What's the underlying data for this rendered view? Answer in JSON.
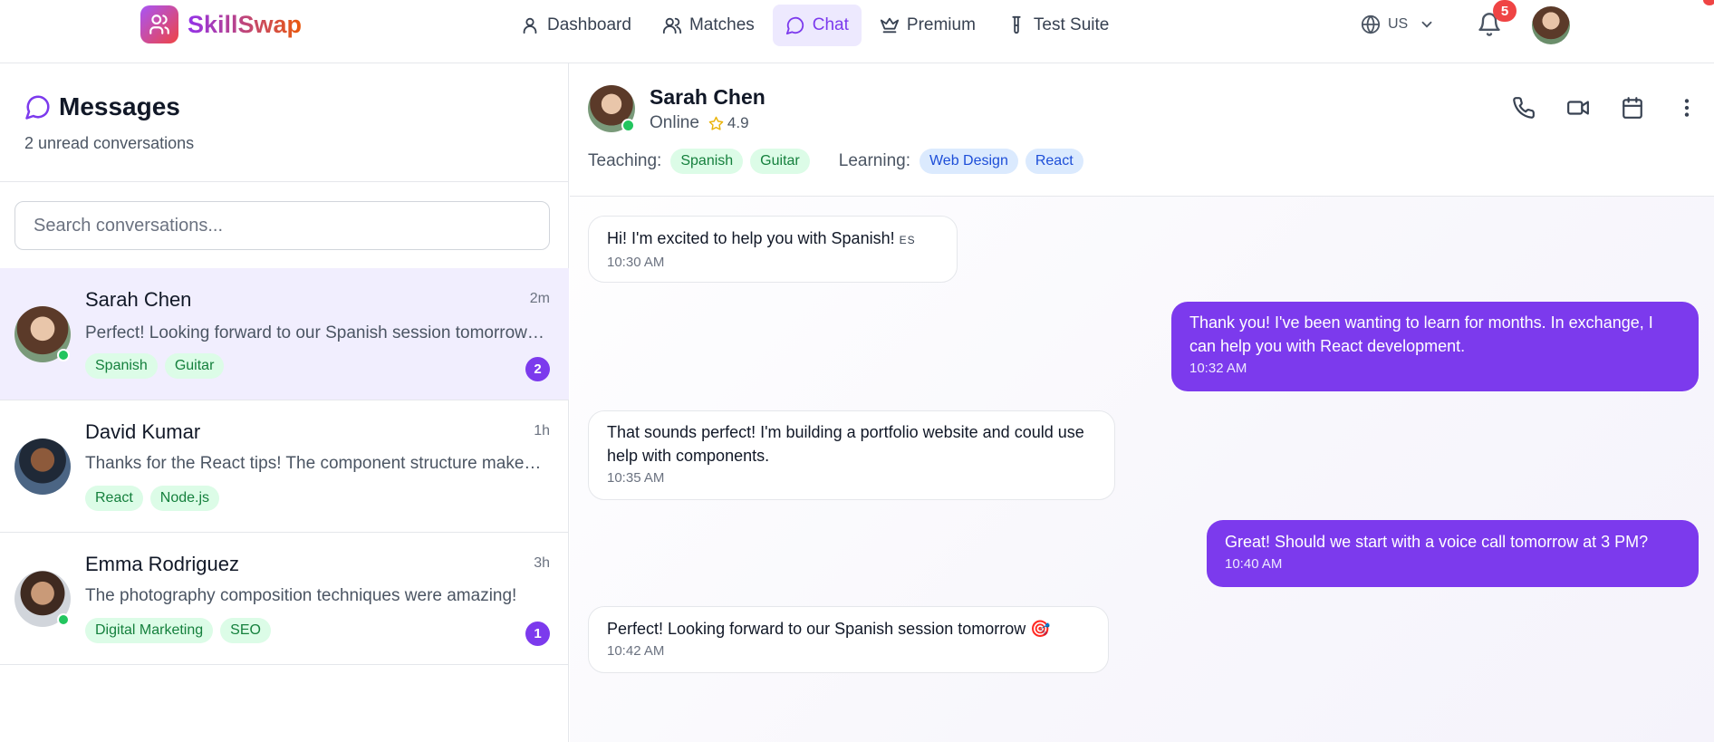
{
  "brand": {
    "name": "SkillSwap"
  },
  "nav": {
    "items": [
      {
        "label": "Dashboard",
        "icon": "user-icon"
      },
      {
        "label": "Matches",
        "icon": "users-icon"
      },
      {
        "label": "Chat",
        "icon": "message-icon",
        "active": true
      },
      {
        "label": "Premium",
        "icon": "crown-icon"
      },
      {
        "label": "Test Suite",
        "icon": "test-tube-icon"
      }
    ],
    "language": "US",
    "notification_count": "5"
  },
  "sidebar": {
    "title": "Messages",
    "subtitle": "2 unread conversations",
    "search_placeholder": "Search conversations...",
    "conversations": [
      {
        "name": "Sarah Chen",
        "time": "2m",
        "preview": "Perfect! Looking forward to our Spanish session tomorrow 🎯",
        "tags": [
          "Spanish",
          "Guitar"
        ],
        "unread": "2",
        "online": true
      },
      {
        "name": "David Kumar",
        "time": "1h",
        "preview": "Thanks for the React tips! The component structure makes so much more sense now.",
        "tags": [
          "React",
          "Node.js"
        ],
        "unread": "",
        "online": false
      },
      {
        "name": "Emma Rodriguez",
        "time": "3h",
        "preview": "The photography composition techniques were amazing!",
        "tags": [
          "Digital Marketing",
          "SEO"
        ],
        "unread": "1",
        "online": true
      }
    ]
  },
  "chat": {
    "name": "Sarah Chen",
    "status": "Online",
    "rating": "4.9",
    "teaching_label": "Teaching:",
    "teaching": [
      "Spanish",
      "Guitar"
    ],
    "learning_label": "Learning:",
    "learning": [
      "Web Design",
      "React"
    ],
    "messages": [
      {
        "direction": "in",
        "text": "Hi! I'm excited to help you with Spanish!",
        "flag": "ES",
        "time": "10:30 AM"
      },
      {
        "direction": "out",
        "text": "Thank you! I've been wanting to learn for months. In exchange, I can help you with React development.",
        "time": "10:32 AM"
      },
      {
        "direction": "in",
        "text": "That sounds perfect! I'm building a portfolio website and could use help with components.",
        "time": "10:35 AM"
      },
      {
        "direction": "out",
        "text": "Great! Should we start with a voice call tomorrow at 3 PM?",
        "time": "10:40 AM"
      },
      {
        "direction": "in",
        "text": "Perfect! Looking forward to our Spanish session tomorrow",
        "emoji": "🎯",
        "time": "10:42 AM"
      }
    ]
  },
  "colors": {
    "accent": "#7c3aed",
    "online": "#22c55e",
    "badge": "#ef4444"
  }
}
